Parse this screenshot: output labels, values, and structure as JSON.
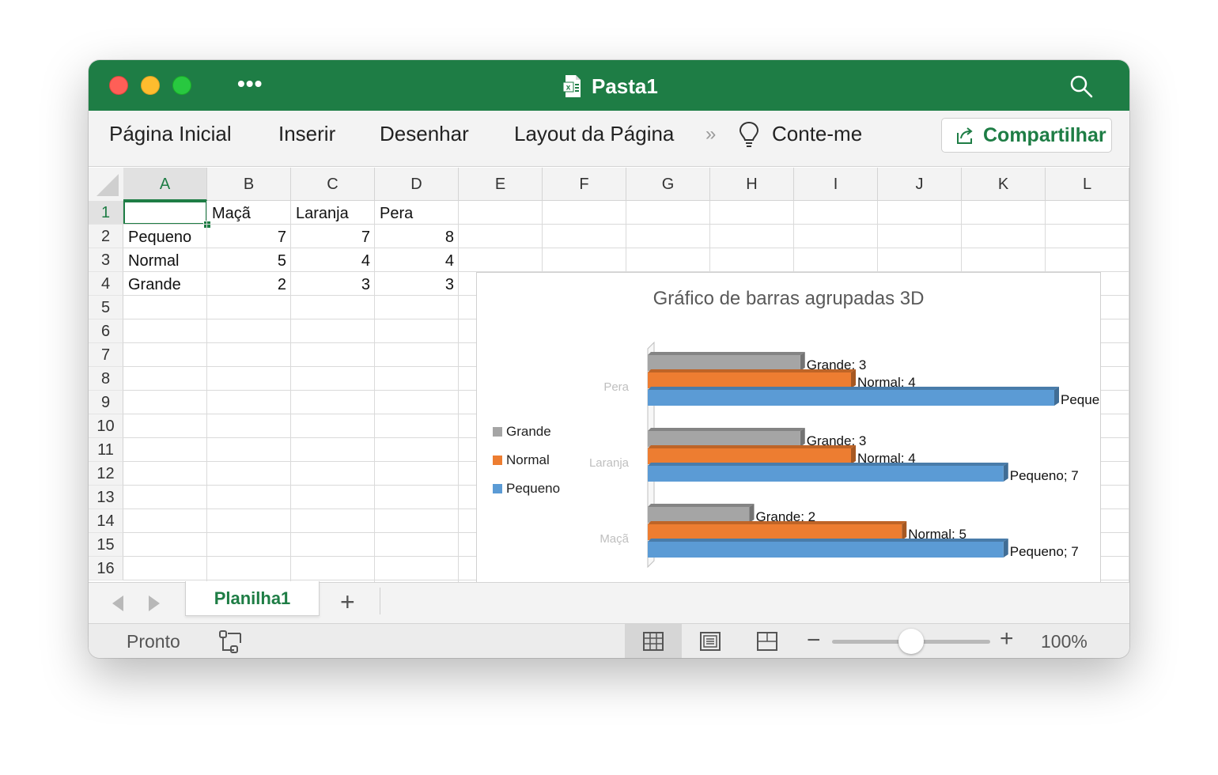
{
  "window": {
    "title": "Pasta1",
    "more_label": "•••"
  },
  "ribbon": {
    "tabs": [
      "Página Inicial",
      "Inserir",
      "Desenhar",
      "Layout da Página"
    ],
    "more_chevrons": "»",
    "tell_me": "Conte-me",
    "share_label": "Compartilhar"
  },
  "sheet": {
    "columns": [
      "A",
      "B",
      "C",
      "D",
      "E",
      "F",
      "G",
      "H",
      "I",
      "J",
      "K",
      "L"
    ],
    "rows": [
      "1",
      "2",
      "3",
      "4",
      "5",
      "6",
      "7",
      "8",
      "9",
      "10",
      "11",
      "12",
      "13",
      "14",
      "15",
      "16"
    ],
    "selected_cell": "A1",
    "headers": [
      "",
      "Maçã",
      "Laranja",
      "Pera"
    ],
    "data": [
      [
        "Pequeno",
        "7",
        "7",
        "8"
      ],
      [
        "Normal",
        "5",
        "4",
        "4"
      ],
      [
        "Grande",
        "2",
        "3",
        "3"
      ]
    ]
  },
  "chart_data": {
    "type": "bar",
    "orientation": "horizontal",
    "style": "3D clustered bar",
    "title": "Gráfico de barras agrupadas 3D",
    "categories": [
      "Maçã",
      "Laranja",
      "Pera"
    ],
    "series": [
      {
        "name": "Pequeno",
        "values": [
          7,
          7,
          8
        ],
        "color": "#5b9bd5"
      },
      {
        "name": "Normal",
        "values": [
          5,
          4,
          4
        ],
        "color": "#ed7d31"
      },
      {
        "name": "Grande",
        "values": [
          2,
          3,
          3
        ],
        "color": "#a5a5a5"
      }
    ],
    "x_ticks": [
      "0",
      "1",
      "2",
      "3",
      "4",
      "5",
      "6",
      "7",
      "8"
    ],
    "xlim": [
      0,
      8
    ],
    "legend_position": "left",
    "data_labels": "series name; value",
    "grid": false
  },
  "tabs": {
    "sheet_name": "Planilha1",
    "add_label": "+"
  },
  "status": {
    "ready": "Pronto",
    "zoom_minus": "−",
    "zoom_plus": "+",
    "zoom": "100%",
    "zoom_level_percent": 100
  },
  "icons": {
    "file": "excel-file-icon",
    "search": "search-icon",
    "tell_me": "lightbulb-icon",
    "share": "share-icon",
    "macro": "macro-record-icon",
    "views": [
      "normal-view-icon",
      "page-layout-view-icon",
      "page-break-preview-icon"
    ]
  },
  "colors": {
    "brand_green": "#1e7d45"
  }
}
